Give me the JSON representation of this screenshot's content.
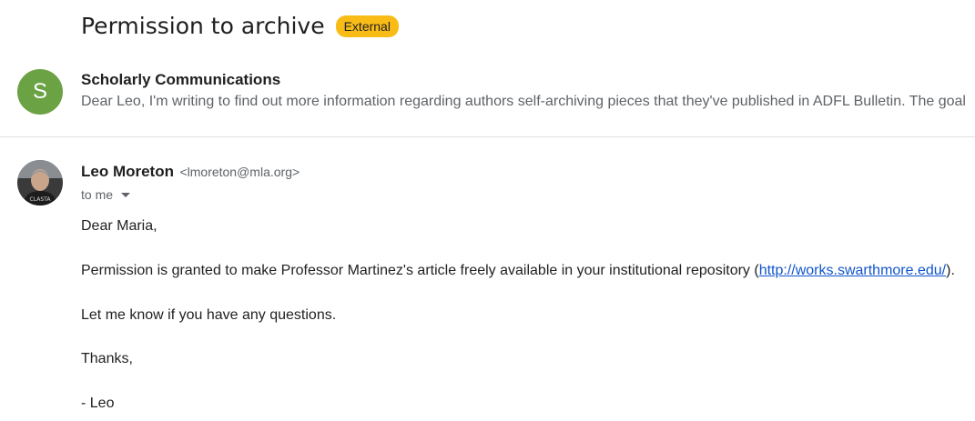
{
  "subject": "Permission to archive",
  "external_label": "External",
  "messages": [
    {
      "avatar_letter": "S",
      "sender": "Scholarly Communications",
      "snippet": "Dear Leo, I'm writing to find out more information regarding authors self-archiving pieces that they've published in ADFL Bulletin. The goal"
    },
    {
      "sender": "Leo Moreton",
      "email": "<lmoreton@mla.org>",
      "to": "to me",
      "avatar_caption": "CLASTA",
      "body": {
        "greeting": "Dear Maria,",
        "para1_before": "Permission is granted to make Professor Martinez's article freely available in your institutional repository (",
        "para1_link": "http://works.swarthmore.edu/",
        "para1_after": ").",
        "para2": "Let me know if you have any questions.",
        "thanks": "Thanks,",
        "signoff": "- Leo"
      }
    }
  ],
  "colors": {
    "external_label": "#f9bc17",
    "avatar_s": "#6aa244",
    "link": "#1155cc"
  }
}
